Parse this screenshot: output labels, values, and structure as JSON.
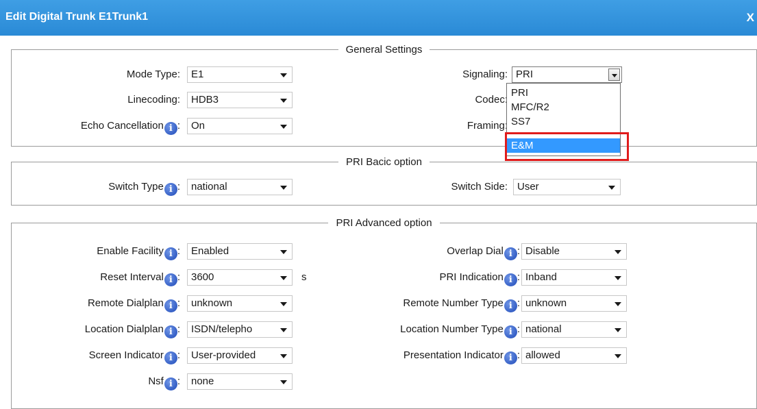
{
  "dialog": {
    "title": "Edit Digital Trunk E1Trunk1",
    "close_label": "X"
  },
  "general": {
    "legend": "General Settings",
    "mode_type": {
      "label": "Mode Type:",
      "value": "E1"
    },
    "linecoding": {
      "label": "Linecoding:",
      "value": "HDB3"
    },
    "echo_cancellation": {
      "label": "Echo Cancellation",
      "sep": ":",
      "value": "On"
    },
    "signaling": {
      "label": "Signaling:",
      "value": "PRI"
    },
    "codec": {
      "label": "Codec:"
    },
    "framing": {
      "label": "Framing:"
    },
    "signaling_options": [
      "PRI",
      "MFC/R2",
      "SS7",
      "E&M"
    ],
    "highlighted_option": "E&M"
  },
  "pri_basic": {
    "legend": "PRI Bacic option",
    "switch_type": {
      "label": "Switch Type",
      "sep": ":",
      "value": "national"
    },
    "switch_side": {
      "label": "Switch Side:",
      "value": "User"
    }
  },
  "pri_advanced": {
    "legend": "PRI Advanced option",
    "enable_facility": {
      "label": "Enable Facility",
      "sep": ":",
      "value": "Enabled"
    },
    "reset_interval": {
      "label": "Reset Interval",
      "sep": ":",
      "value": "3600",
      "unit": "s"
    },
    "remote_dialplan": {
      "label": "Remote Dialplan",
      "sep": ":",
      "value": "unknown"
    },
    "location_dialplan": {
      "label": "Location Dialplan",
      "sep": ":",
      "value": "ISDN/telepho"
    },
    "screen_indicator": {
      "label": "Screen Indicator",
      "sep": ":",
      "value": "User-provided"
    },
    "nsf": {
      "label": "Nsf",
      "sep": ":",
      "value": "none"
    },
    "overlap_dial": {
      "label": "Overlap Dial",
      "sep": ":",
      "value": "Disable"
    },
    "pri_indication": {
      "label": "PRI Indication",
      "sep": ":",
      "value": "Inband"
    },
    "remote_number_type": {
      "label": "Remote Number Type",
      "sep": ":",
      "value": "unknown"
    },
    "location_number_type": {
      "label": "Location Number Type",
      "sep": ":",
      "value": "national"
    },
    "presentation_indicator": {
      "label": "Presentation Indicator",
      "sep": ":",
      "value": "allowed"
    }
  },
  "icons": {
    "info": "info-icon",
    "dropdown": "chevron-down-icon"
  },
  "colors": {
    "title_bar": "#2a8ad6",
    "highlight": "#3399ff",
    "annotation_box": "#e01c1c"
  }
}
